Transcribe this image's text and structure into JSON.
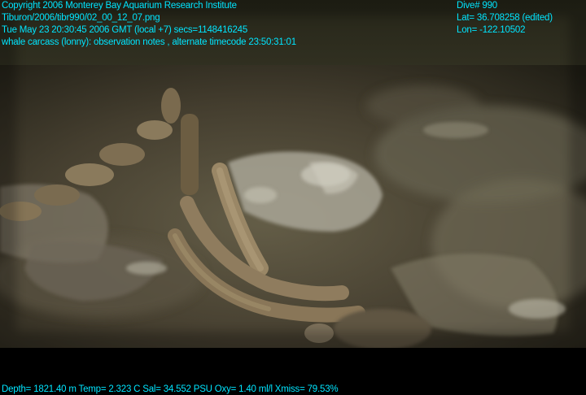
{
  "overlay": {
    "color": "#00e5ff",
    "left_lines": [
      "Copyright 2006 Monterey Bay Aquarium Research Institute",
      "Tiburon/2006/tibr990/02_00_12_07.png",
      "Tue May 23 20:30:45 2006 GMT (local +7)  secs=1148416245",
      "whale carcass (lonny): observation notes , alternate timecode 23:50:31:01"
    ],
    "right_lines": [
      "Dive# 990",
      "Lat= 36.708258 (edited)",
      "Lon= -122.10502"
    ],
    "bottom_line": "Depth= 1821.40 m  Temp= 2.323 C  Sal= 34.552 PSU  Oxy= 1.40 ml/l  Xmiss= 79.53%"
  },
  "scene": {
    "water_color": "#3a3a2a",
    "sediment_color": "#4a4433",
    "bone_color": "#8a7a5c",
    "highlight_color": "#b7b3a3"
  }
}
